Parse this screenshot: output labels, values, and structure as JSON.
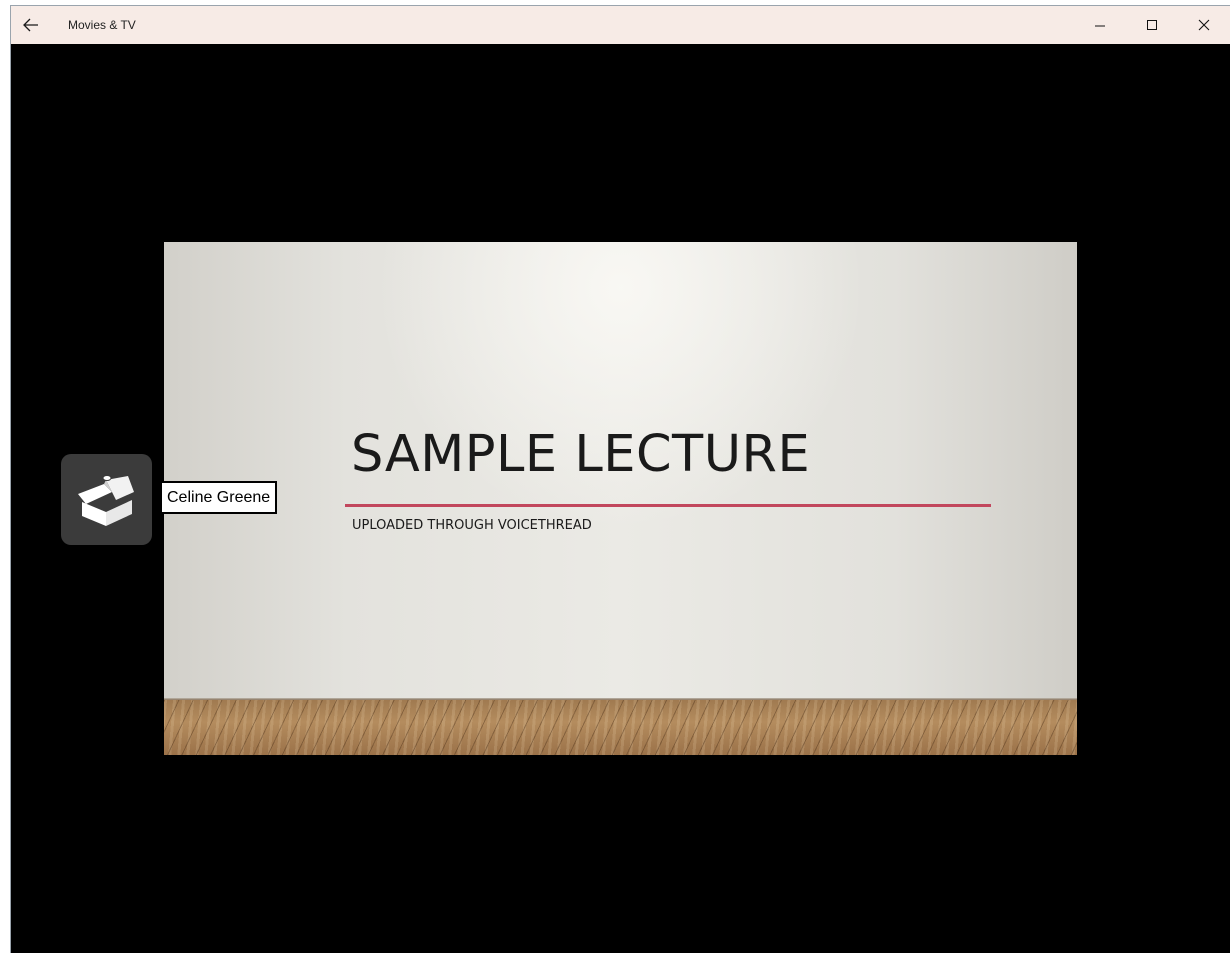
{
  "window": {
    "title": "Movies & TV",
    "icons": {
      "back": "back-arrow-icon",
      "minimize": "minimize-icon",
      "maximize": "maximize-icon",
      "close": "close-icon"
    }
  },
  "slide": {
    "title": "SAMPLE LECTURE",
    "subtitle": "UPLOADED THROUGH VOICETHREAD",
    "accent_color": "#c2475d"
  },
  "commenter": {
    "icon": "voicethread-box-icon",
    "name": "Celine Greene"
  }
}
